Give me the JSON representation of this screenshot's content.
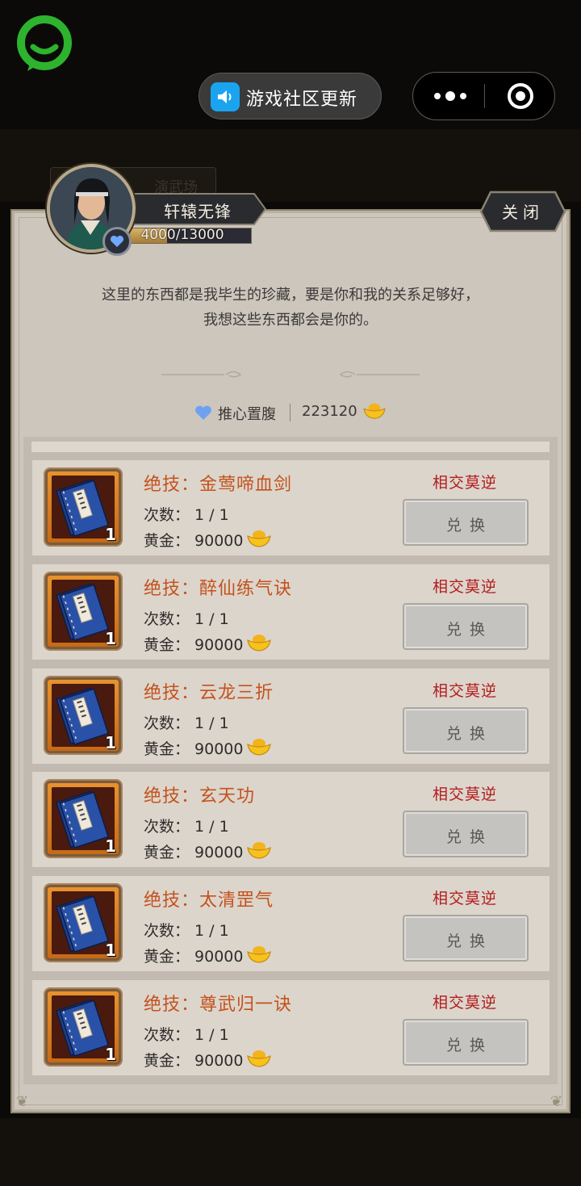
{
  "topbar": {
    "notice_text": "游戏社区更新",
    "more_icon": "more-dots-icon",
    "close_icon": "target-circle-icon"
  },
  "npc": {
    "name": "轩辕无锋",
    "affinity_text": "4000/13000",
    "affinity_current": 4000,
    "affinity_max": 13000,
    "close_label": "关闭",
    "description_line1": "这里的东西都是我毕生的珍藏，要是你和我的关系足够好，",
    "description_line2": "我想这些东西都会是你的。"
  },
  "stats": {
    "relation_label": "推心置腹",
    "gold_amount": "223120"
  },
  "background": {
    "ghost_text": "演武场"
  },
  "items": [
    {
      "title": "绝技：金莺啼血剑",
      "times": "次数：  1 / 1",
      "gold": "黄金：  90000",
      "requirement": "相交莫逆",
      "button": "兑换",
      "count": "1"
    },
    {
      "title": "绝技：醉仙练气诀",
      "times": "次数：  1 / 1",
      "gold": "黄金：  90000",
      "requirement": "相交莫逆",
      "button": "兑换",
      "count": "1"
    },
    {
      "title": "绝技：云龙三折",
      "times": "次数：  1 / 1",
      "gold": "黄金：  90000",
      "requirement": "相交莫逆",
      "button": "兑换",
      "count": "1"
    },
    {
      "title": "绝技：玄天功",
      "times": "次数：  1 / 1",
      "gold": "黄金：  90000",
      "requirement": "相交莫逆",
      "button": "兑换",
      "count": "1"
    },
    {
      "title": "绝技：太清罡气",
      "times": "次数：  1 / 1",
      "gold": "黄金：  90000",
      "requirement": "相交莫逆",
      "button": "兑换",
      "count": "1"
    },
    {
      "title": "绝技：尊武归一诀",
      "times": "次数：  1 / 1",
      "gold": "黄金：  90000",
      "requirement": "相交莫逆",
      "button": "兑换",
      "count": "1"
    }
  ],
  "colors": {
    "title_orange": "#c4521c",
    "requirement_red": "#b31c1c",
    "panel": "#cdc6bd",
    "card": "#dcd5cc"
  }
}
